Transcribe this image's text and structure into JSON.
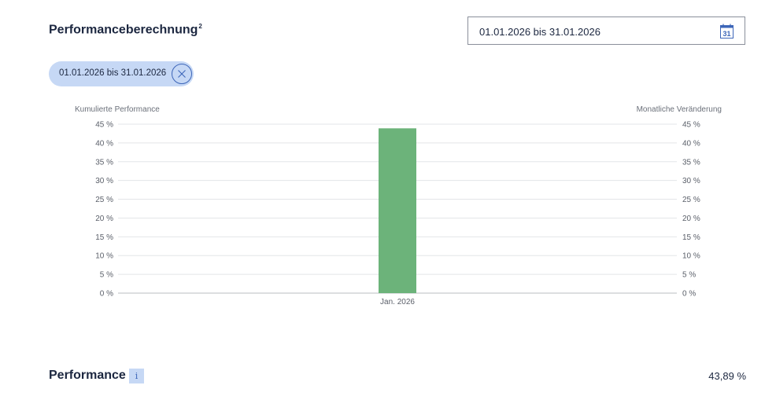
{
  "header": {
    "title": "Performanceberechnung",
    "footnote": "2",
    "date_range_value": "01.01.2026 bis 31.01.2026",
    "calendar_icon": "calendar-icon",
    "calendar_icon_day": "31"
  },
  "filter_chip": {
    "label": "01.01.2026 bis 31.01.2026",
    "close_icon": "close-icon"
  },
  "chart_data": {
    "type": "bar",
    "categories": [
      "Jan. 2026"
    ],
    "values": [
      43.89
    ],
    "ylabel_left": "Kumulierte Performance",
    "ylabel_right": "Monatliche Veränderung",
    "ylim": [
      0,
      45
    ],
    "yticks": [
      "0 %",
      "5 %",
      "10 %",
      "15 %",
      "20 %",
      "25 %",
      "30 %",
      "35 %",
      "40 %",
      "45 %"
    ],
    "grid": true,
    "bar_color": "#6cb37a"
  },
  "summary": {
    "label": "Performance",
    "info_icon_text": "i",
    "value": "43,89 %"
  }
}
